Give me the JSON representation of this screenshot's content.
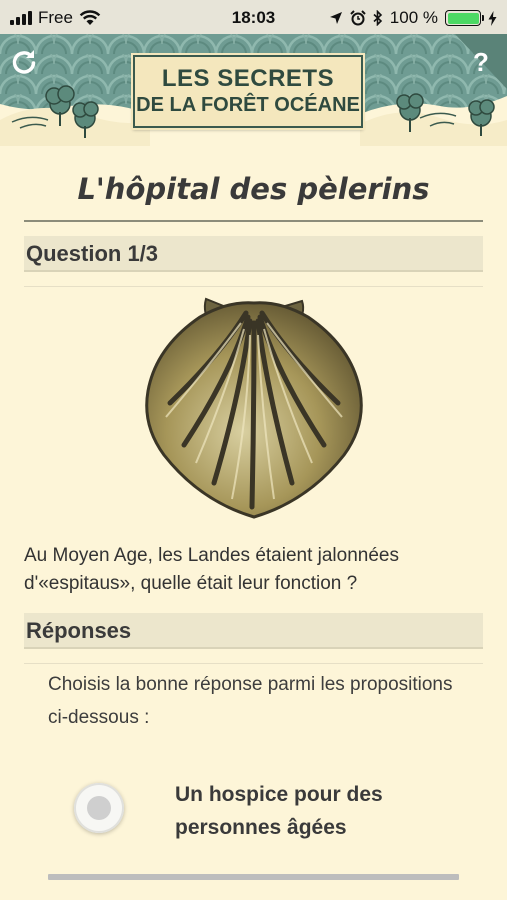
{
  "status_bar": {
    "carrier": "Free",
    "time": "18:03",
    "battery": "100 %",
    "battery_level": 1.0,
    "icons": [
      "signal-icon",
      "wifi-icon",
      "location-icon",
      "alarm-icon",
      "bluetooth-icon",
      "battery-icon",
      "charging-icon"
    ]
  },
  "header": {
    "title_line1": "LES SECRETS",
    "title_line2": "DE LA FORÊT OCÉANE",
    "restart_icon": "↻",
    "help_icon": "?"
  },
  "page": {
    "title": "L'hôpital des pèlerins"
  },
  "question": {
    "heading": "Question 1/3",
    "text": "Au Moyen Age, les Landes étaient jalonnées d'«espitaus», quelle était leur fonction ?",
    "image": "scallop-shell-icon"
  },
  "responses": {
    "heading": "Réponses",
    "instruction": "Choisis la bonne réponse parmi les propositions ci-dessous :",
    "options": [
      {
        "label": "Un hospice pour des personnes âgées",
        "selected": false
      }
    ]
  },
  "colors": {
    "background": "#fdf5d8",
    "header_teal": "#6f9c93",
    "plaque": "#f4e7bd",
    "plaque_text": "#2f4a3f",
    "section_bar": "#ece6cc"
  }
}
